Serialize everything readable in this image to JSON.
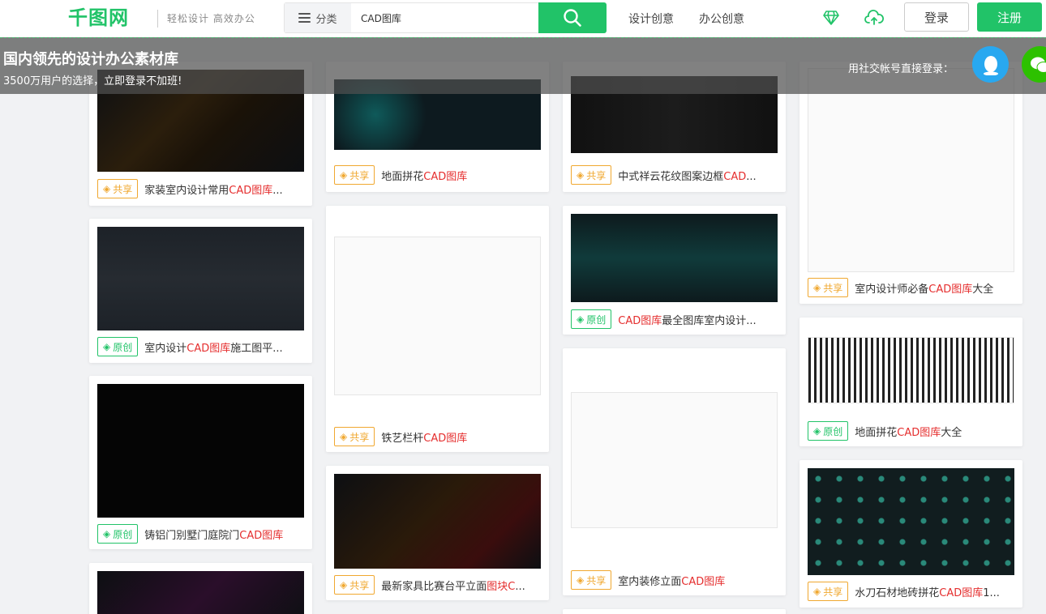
{
  "header": {
    "logo_text": "千图网",
    "slogan": "轻松设计 高效办公",
    "category_label": "分类",
    "search_value": "CAD图库",
    "nav_design": "设计创意",
    "nav_office": "办公创意",
    "login_label": "登录",
    "register_label": "注册"
  },
  "banner": {
    "title": "国内领先的设计办公素材库",
    "subtitle": "3500万用户的选择，立即登录不加班!",
    "social_login_label": "用社交帐号直接登录："
  },
  "badges": {
    "share": "共享",
    "original": "原创"
  },
  "cards": {
    "c1": {
      "pre": "家装室内设计常用",
      "hl": "CAD图库",
      "post": "..."
    },
    "c2": {
      "pre": "室内设计",
      "hl": "CAD图库",
      "post": "施工图平..."
    },
    "c3": {
      "pre": "铸铝门别墅门庭院门",
      "hl": "CAD图库",
      "post": ""
    },
    "c4": {
      "pre": "地面拼花",
      "hl": "CAD图库",
      "post": ""
    },
    "c5": {
      "pre": "铁艺栏杆",
      "hl": "CAD图库",
      "post": ""
    },
    "c6": {
      "pre": "最新家具比赛台平立面",
      "hl": "图块C",
      "post": "..."
    },
    "c7": {
      "pre": "中式祥云花纹图案边框",
      "hl": "CAD",
      "post": "..."
    },
    "c8": {
      "pre": "",
      "hl": "CAD图库",
      "post": "最全图库室内设计..."
    },
    "c9": {
      "pre": "室内装修立面",
      "hl": "CAD图库",
      "post": ""
    },
    "c10": {
      "pre": "室内设计师必备",
      "hl": "CAD图库",
      "post": "大全"
    },
    "c11": {
      "pre": "地面拼花",
      "hl": "CAD图库",
      "post": "大全"
    },
    "c12": {
      "pre": "水刀石材地砖拼花",
      "hl": "CAD图库",
      "post": "1..."
    }
  },
  "colors": {
    "brand_green": "#21c368",
    "share_orange": "#f0a830",
    "highlight_red": "#e52e2e"
  }
}
